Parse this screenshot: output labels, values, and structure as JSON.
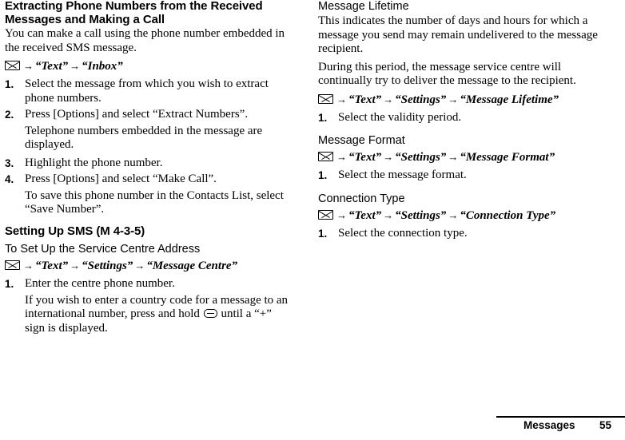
{
  "left_column": {
    "heading": "Extracting Phone Numbers from the Received Messages and Making a Call",
    "intro": "You can make a call using the phone number embedded in the received SMS message.",
    "nav1": {
      "icon": "envelope-icon",
      "items": [
        "“Text”",
        "“Inbox”"
      ]
    },
    "steps1": [
      {
        "num": "1.",
        "text": "Select the message from which you wish to extract phone numbers."
      },
      {
        "num": "2.",
        "text": "Press [Options] and select “Extract Numbers”."
      },
      {
        "num": "3.",
        "text": "Highlight the phone number."
      },
      {
        "num": "4.",
        "text": "Press [Options] and select “Make Call”."
      }
    ],
    "note_after_step2": "Telephone numbers embedded in the message are displayed.",
    "note_after_step4": "To save this phone number in the Contacts List, select “Save Number”.",
    "section2_heading": "Setting Up SMS",
    "section2_code": "(M 4-3-5)",
    "section2_subheading": "To Set Up the Service Centre Address",
    "nav2": {
      "icon": "envelope-icon",
      "items": [
        "“Text”",
        "“Settings”",
        "“Message Centre”"
      ]
    },
    "steps2": [
      {
        "num": "1.",
        "text": "Enter the centre phone number."
      }
    ],
    "note2_part1": "If you wish to enter a country code for a message to an international number, press and hold",
    "note2_icon": "asterisk-key-icon",
    "note2_part2": "until a “+” sign is displayed."
  },
  "right_column": {
    "heading1": "Message Lifetime",
    "para1": "This indicates the number of days and hours for which a message you send may remain undelivered to the message recipient.",
    "para2": "During this period, the message service centre will continually try to deliver the message to the recipient.",
    "nav1": {
      "icon": "envelope-icon",
      "items": [
        "“Text”",
        "“Settings”",
        "“Message Lifetime”"
      ]
    },
    "steps1": [
      {
        "num": "1.",
        "text": "Select the validity period."
      }
    ],
    "heading2": "Message Format",
    "nav2": {
      "icon": "envelope-icon",
      "items": [
        "“Text”",
        "“Settings”",
        "“Message Format”"
      ]
    },
    "steps2": [
      {
        "num": "1.",
        "text": "Select the message format."
      }
    ],
    "heading3": "Connection Type",
    "nav3": {
      "icon": "envelope-icon",
      "items": [
        "“Text”",
        "“Settings”",
        "“Connection Type”"
      ]
    },
    "steps3": [
      {
        "num": "1.",
        "text": "Select the connection type."
      }
    ]
  },
  "footer": {
    "label": "Messages",
    "page": "55"
  }
}
